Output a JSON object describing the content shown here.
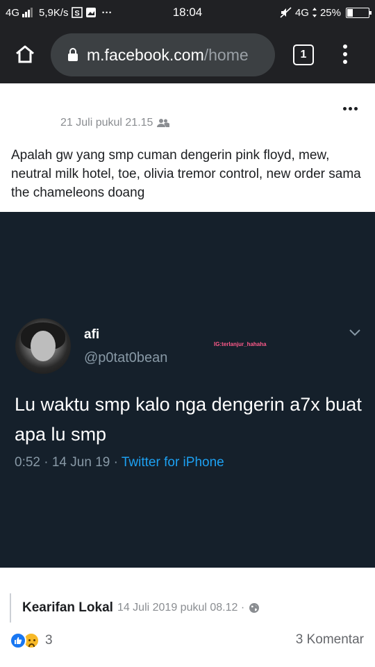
{
  "status_bar": {
    "network": "4G",
    "speed": "5,9K/s",
    "more": "···",
    "time": "18:04",
    "network_right": "4G",
    "battery_percent": "25%",
    "battery_level": 0.25
  },
  "browser": {
    "url_domain": "m.facebook.com",
    "url_path": "/home",
    "tab_count": "1"
  },
  "post": {
    "timestamp": "21 Juli pukul 21.15",
    "text": "Apalah gw yang smp cuman dengerin pink floyd, mew, neutral milk hotel, toe, olivia tremor control, new order sama the chameleons doang",
    "embedded_tweet": {
      "name": "afi",
      "handle": "@p0tat0bean",
      "watermark": "IG:terlanjur_hahaha",
      "text": "Lu waktu smp kalo nga dengerin a7x buat apa lu smp",
      "time_date": "0:52 · 14 Jun 19 · ",
      "source": "Twitter for iPhone"
    },
    "shared_from": {
      "name": "Kearifan Lokal",
      "timestamp": "14 Juli 2019 pukul 08.12 ·"
    },
    "reactions_count": "3",
    "comments_label": "3 Komentar"
  },
  "colors": {
    "browser_bg": "#202124",
    "url_box": "#3c4043",
    "tweet_bg": "#15202b",
    "twitter_blue": "#1da1f2",
    "facebook_blue": "#1877f2"
  }
}
